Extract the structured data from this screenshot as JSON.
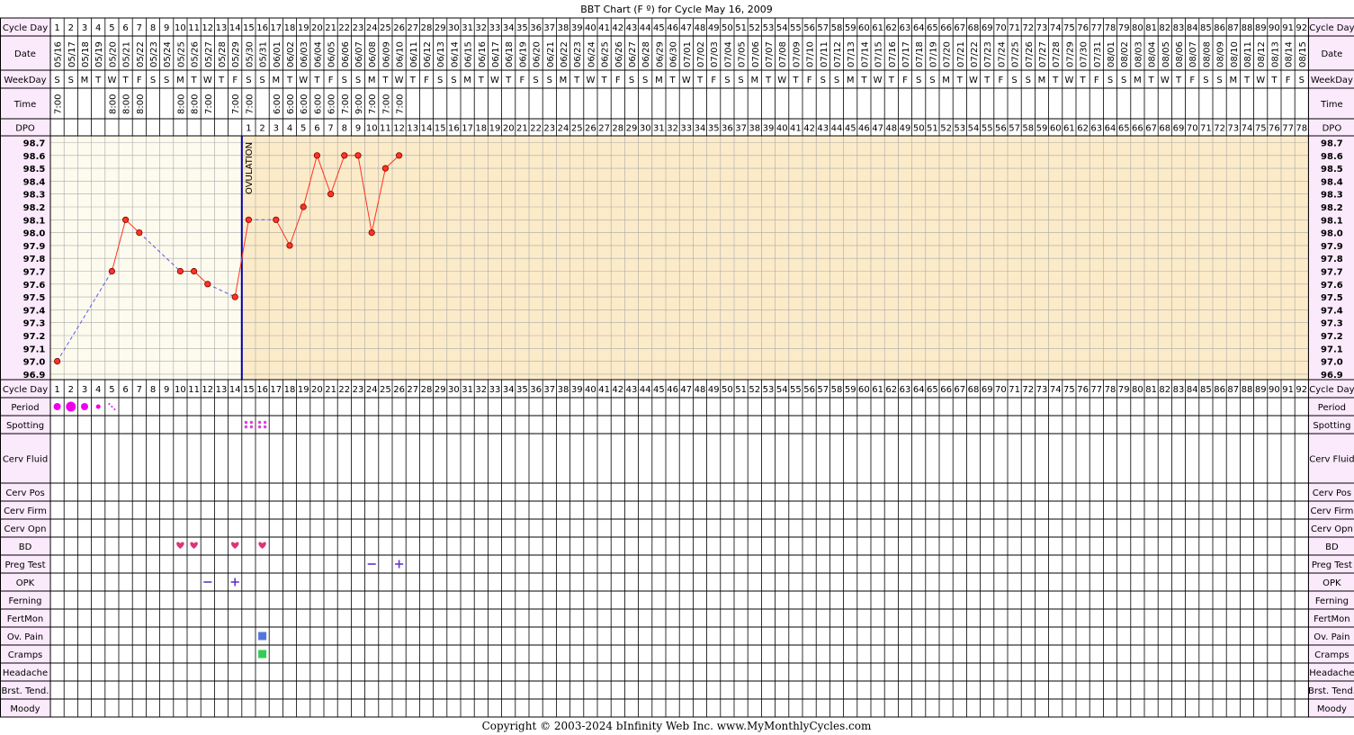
{
  "chart_data": {
    "type": "line",
    "title": "BBT Chart (F º) for Cycle May 16, 2009",
    "copyright": "Copyright © 2003-2024 bInfinity Web Inc.     www.MyMonthlyCycles.com",
    "ovulation_label": "OVULATION",
    "ovulation_day": 14,
    "num_days": 92,
    "num_dpo": 78,
    "ylim": [
      96.9,
      98.7
    ],
    "y_ticks": [
      "98.7",
      "98.6",
      "98.5",
      "98.4",
      "98.3",
      "98.2",
      "98.1",
      "98.0",
      "97.9",
      "97.8",
      "97.7",
      "97.6",
      "97.5",
      "97.4",
      "97.3",
      "97.2",
      "97.1",
      "97.0",
      "96.9"
    ],
    "row_labels": {
      "cycle_day": "Cycle Day",
      "date": "Date",
      "weekday": "WeekDay",
      "time": "Time",
      "dpo": "DPO"
    },
    "lower_rows": [
      "Cycle Day",
      "Period",
      "Spotting",
      "Cerv Fluid",
      "Cerv Pos",
      "Cerv Firm",
      "Cerv Opn",
      "BD",
      "Preg Test",
      "OPK",
      "Ferning",
      "FertMon",
      "Ov. Pain",
      "Cramps",
      "Headache",
      "Brst. Tend.",
      "Moody"
    ],
    "dates": [
      "05/16",
      "05/17",
      "05/18",
      "05/19",
      "05/20",
      "05/21",
      "05/22",
      "05/23",
      "05/24",
      "05/25",
      "05/26",
      "05/27",
      "05/28",
      "05/29",
      "05/30",
      "05/31",
      "06/01",
      "06/02",
      "06/03",
      "06/04",
      "06/05",
      "06/06",
      "06/07",
      "06/08",
      "06/09",
      "06/10",
      "06/11",
      "06/12",
      "06/13",
      "06/14",
      "06/15",
      "06/16",
      "06/17",
      "06/18",
      "06/19",
      "06/20",
      "06/21",
      "06/22",
      "06/23",
      "06/24",
      "06/25",
      "06/26",
      "06/27",
      "06/28",
      "06/29",
      "06/30",
      "07/01",
      "07/02",
      "07/03",
      "07/04",
      "07/05",
      "07/06",
      "07/07",
      "07/08",
      "07/09",
      "07/10",
      "07/11",
      "07/12",
      "07/13",
      "07/14",
      "07/15",
      "07/16",
      "07/17",
      "07/18",
      "07/19",
      "07/20",
      "07/21",
      "07/22",
      "07/23",
      "07/24",
      "07/25",
      "07/26",
      "07/27",
      "07/28",
      "07/29",
      "07/30",
      "07/31",
      "08/01",
      "08/02",
      "08/03",
      "08/04",
      "08/05",
      "08/06",
      "08/07",
      "08/08",
      "08/09",
      "08/10",
      "08/11",
      "08/12",
      "08/13",
      "08/14",
      "08/15"
    ],
    "weekday_cycle": [
      "S",
      "S",
      "M",
      "T",
      "W",
      "T",
      "F"
    ],
    "times": {
      "1": "7:00",
      "5": "8:00",
      "6": "8:00",
      "7": "8:00",
      "10": "8:00",
      "11": "8:00",
      "12": "7:00",
      "14": "7:00",
      "15": "7:00",
      "17": "6:00",
      "18": "6:00",
      "19": "6:00",
      "20": "6:00",
      "21": "6:00",
      "22": "7:00",
      "23": "9:00",
      "24": "7:00",
      "25": "7:00",
      "26": "7:00"
    },
    "series": [
      {
        "points": [
          {
            "day": 1,
            "temp": 97.0
          },
          {
            "day": 5,
            "temp": 97.7
          },
          {
            "day": 6,
            "temp": 98.1
          },
          {
            "day": 7,
            "temp": 98.0
          },
          {
            "day": 10,
            "temp": 97.7
          },
          {
            "day": 11,
            "temp": 97.7
          },
          {
            "day": 12,
            "temp": 97.6
          },
          {
            "day": 14,
            "temp": 97.5
          },
          {
            "day": 15,
            "temp": 98.1
          },
          {
            "day": 17,
            "temp": 98.1
          },
          {
            "day": 18,
            "temp": 97.9
          },
          {
            "day": 19,
            "temp": 98.2
          },
          {
            "day": 20,
            "temp": 98.6
          },
          {
            "day": 21,
            "temp": 98.3
          },
          {
            "day": 22,
            "temp": 98.6
          },
          {
            "day": 23,
            "temp": 98.6
          },
          {
            "day": 24,
            "temp": 98.0
          },
          {
            "day": 25,
            "temp": 98.5
          },
          {
            "day": 26,
            "temp": 98.6
          }
        ]
      }
    ],
    "period": [
      {
        "day": 1,
        "level": "medium"
      },
      {
        "day": 2,
        "level": "heavy"
      },
      {
        "day": 3,
        "level": "medium"
      },
      {
        "day": 4,
        "level": "light"
      },
      {
        "day": 5,
        "level": "spotting"
      }
    ],
    "spotting_days": [
      15,
      16
    ],
    "bd_days": [
      10,
      11,
      14,
      16
    ],
    "preg_tests": [
      {
        "day": 24,
        "result": "negative"
      },
      {
        "day": 26,
        "result": "positive"
      }
    ],
    "opk": [
      {
        "day": 12,
        "result": "negative"
      },
      {
        "day": 14,
        "result": "positive"
      }
    ],
    "ov_pain_days": [
      16
    ],
    "cramps_days": [
      16
    ],
    "colors": {
      "pre_ovulation_bg": "#fdfbee",
      "post_ovulation_bg": "#fcebc9",
      "label_bg": "#fbeafc",
      "grid": "#a9a9a9",
      "temp_line": "#ff3322",
      "dashed_line": "#5a5ae6",
      "ovulation_line": "#0000aa",
      "period": "#ee00ee",
      "spotting": "#e040e0",
      "bd": "#dd3377",
      "test_mark": "#6633cc",
      "ov_pain": "#5577dd",
      "cramps": "#33cc55"
    }
  }
}
